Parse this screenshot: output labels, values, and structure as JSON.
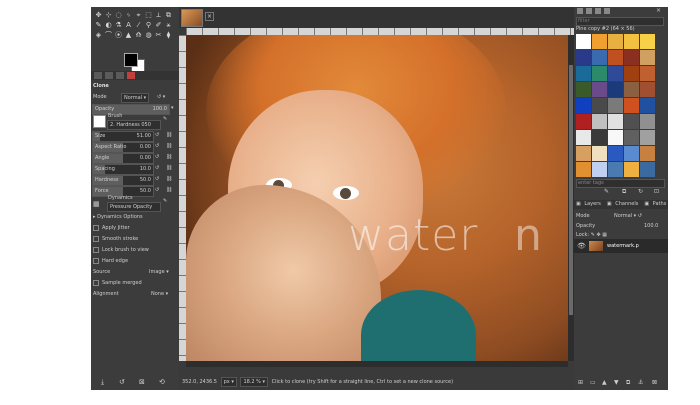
{
  "toolbox": {
    "tools": [
      "✥",
      "⊹",
      "◌",
      "ᛃ",
      "⌖",
      "⬚",
      "⟂",
      "⧉",
      "✎",
      "◐",
      "⚗",
      "A",
      "⁄",
      "⚲",
      "✐",
      "⚹",
      "◈",
      "⌒",
      "⦿",
      "▲",
      "⟰",
      "◍",
      "✂",
      "⧫"
    ],
    "options_title": "Clone",
    "mode_label": "Mode",
    "mode_value": "Normal",
    "opacity_label": "Opacity",
    "opacity_value": "100.0",
    "brush_label": "Brush",
    "brush_value": "2. Hardness 050",
    "size_label": "Size",
    "size_value": "51.00",
    "aspect_label": "Aspect Ratio",
    "aspect_value": "0.00",
    "angle_label": "Angle",
    "angle_value": "0.00",
    "spacing_label": "Spacing",
    "spacing_value": "10.0",
    "hardness_label": "Hardness",
    "hardness_value": "50.0",
    "force_label": "Force",
    "force_value": "50.0",
    "dynamics_label": "Dynamics",
    "dynamics_value": "Pressure Opacity",
    "dynamics_options": "Dynamics Options",
    "apply_jitter": "Apply Jitter",
    "smooth_stroke": "Smooth stroke",
    "lock_brush": "Lock brush to view",
    "hard_edge": "Hard edge",
    "source_label": "Source",
    "source_value": "Image",
    "sample_merged": "Sample merged",
    "alignment_label": "Alignment",
    "alignment_value": "None"
  },
  "canvas": {
    "watermark_text": "water",
    "watermark_tail": "n",
    "status_coords": "352.0, 2436.5",
    "status_unit": "px",
    "status_zoom": "18.2 %",
    "status_message": "Click to clone (try Shift for a straight line, Ctrl to set a new clone source)"
  },
  "right": {
    "filter_placeholder": "filter",
    "pattern_label": "Pine copy #2 (64 × 56)",
    "patterns": [
      "#ffffff",
      "#f0a030",
      "#e8b040",
      "#f4c040",
      "#f8d048",
      "#2a3a8a",
      "#3a6ab0",
      "#c05020",
      "#8a3020",
      "#d0a060",
      "#1a6a9a",
      "#2a8a6a",
      "#304a9a",
      "#a04010",
      "#c06030",
      "#3a5a2a",
      "#6a4a8a",
      "#1a3a7a",
      "#8a6040",
      "#a05030",
      "#1040c0",
      "#4a4a4a",
      "#7a7a7a",
      "#d05020",
      "#2050a0",
      "#b02020",
      "#c0c0c0",
      "#e0e0e0",
      "#505050",
      "#909090",
      "#e8e8e8",
      "#3a3a3a",
      "#f8f8f8",
      "#606060",
      "#a0a0a0",
      "#d8a060",
      "#f0e0c0",
      "#2a5ac0",
      "#5a8ad0",
      "#c88040",
      "#e09030",
      "#c0d0f0",
      "#4a7ab0",
      "#f0b040",
      "#3a6aa0"
    ],
    "tags_placeholder": "enter tags",
    "layers_tab": "Layers",
    "channels_tab": "Channels",
    "paths_tab": "Paths",
    "mode_label": "Mode",
    "mode_value": "Normal",
    "opacity_label": "Opacity",
    "opacity_value": "100.0",
    "lock_label": "Lock:",
    "layer_name": "watermark.p"
  }
}
